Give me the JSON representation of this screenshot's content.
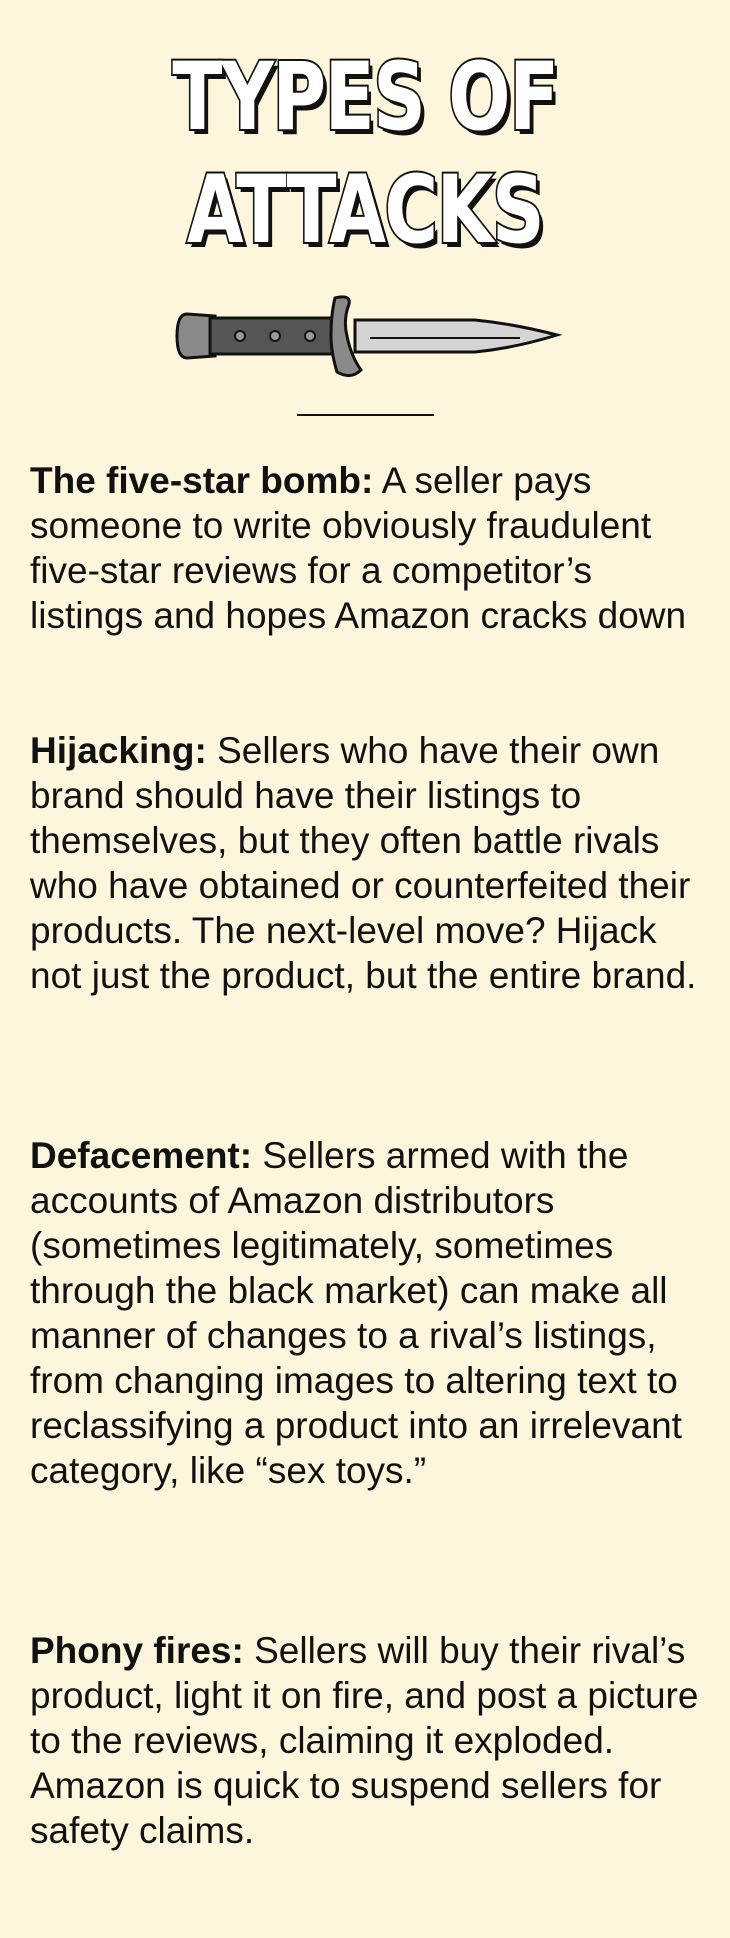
{
  "title": {
    "line1": "TYPES OF",
    "line2": "ATTACKS"
  },
  "icons": {
    "knife": "knife-icon"
  },
  "colors": {
    "background": "#fdf6dc",
    "text": "#111111",
    "blade": "#d4d4d4",
    "handle": "#555555",
    "guard": "#8a8a8a"
  },
  "attacks": [
    {
      "term": "The five-star bomb:",
      "description": "A seller pays someone to write obviously fraudulent five-star reviews for a competitor’s listings and hopes Amazon cracks down"
    },
    {
      "term": "Hijacking:",
      "description": "Sellers who have their own brand should have their listings to themselves, but they often battle rivals who have obtained or counterfeited their products. The next-level move? Hijack not just the product, but the entire brand."
    },
    {
      "term": "Defacement:",
      "description": "Sellers armed with the accounts of Amazon distributors (sometimes legitimately, sometimes through the black market) can make all manner of changes to a rival’s listings, from changing images to altering text to reclassifying a product into an irrelevant category, like “sex toys.”"
    },
    {
      "term": "Phony fires:",
      "description": "Sellers will buy their rival’s product, light it on fire, and post a picture to the reviews, claiming it exploded. Amazon is quick to suspend sellers for safety claims."
    }
  ]
}
